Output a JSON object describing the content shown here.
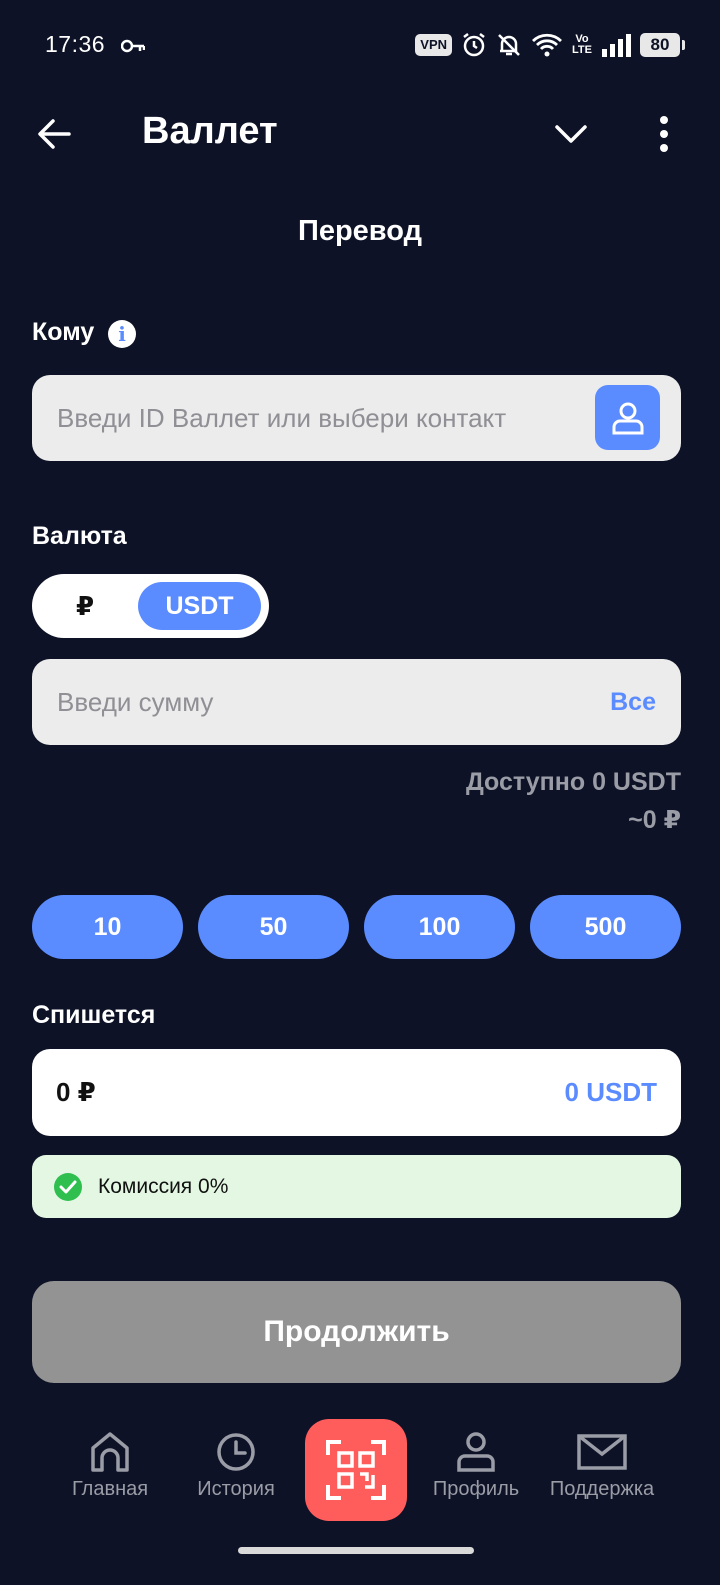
{
  "status_bar": {
    "time": "17:36",
    "vpn": "VPN",
    "volte_top": "Vo",
    "volte_bottom": "LTE",
    "battery": "80"
  },
  "app_bar": {
    "title": "Валлет"
  },
  "screen_title": "Перевод",
  "recipient": {
    "label": "Кому",
    "placeholder": "Введи ID Валлет или выбери контакт"
  },
  "currency": {
    "label": "Валюта",
    "options": [
      "₽",
      "USDT"
    ],
    "selected": "USDT"
  },
  "amount": {
    "placeholder": "Введи сумму",
    "all_label": "Все",
    "available_line1": "Доступно 0 USDT",
    "available_line2": "~0 ₽"
  },
  "quick_amounts": [
    "10",
    "50",
    "100",
    "500"
  ],
  "debit": {
    "label": "Спишется",
    "rub_value": "0 ₽",
    "usdt_value": "0 USDT"
  },
  "commission": {
    "text": "Комиссия 0%"
  },
  "continue_label": "Продолжить",
  "bottom_nav": {
    "items": [
      {
        "label": "Главная",
        "icon": "home-icon"
      },
      {
        "label": "История",
        "icon": "clock-icon"
      },
      {
        "label": "",
        "icon": "qr-scan-icon"
      },
      {
        "label": "Профиль",
        "icon": "profile-icon"
      },
      {
        "label": "Поддержка",
        "icon": "mail-icon"
      }
    ]
  },
  "colors": {
    "background": "#0d1226",
    "accent": "#5b8cff",
    "scan": "#ff5c5c",
    "commission_bg": "#e3f7e3",
    "disabled_button": "#939393"
  }
}
